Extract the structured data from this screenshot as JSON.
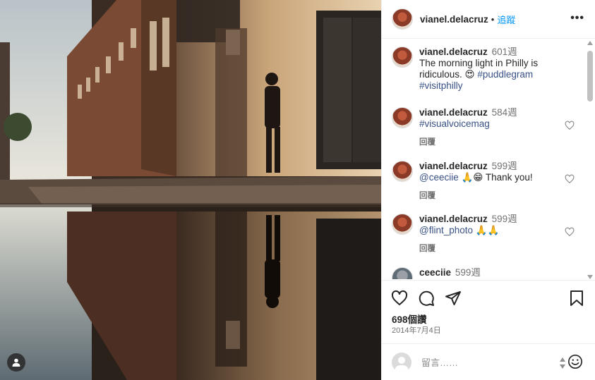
{
  "post": {
    "username": "vianel.delacruz",
    "separator": "•",
    "follow_label": "追蹤",
    "more_label": "•••"
  },
  "comments": [
    {
      "username": "vianel.delacruz",
      "time": "601週",
      "text": "The morning light in Philly is ridiculous. 😍 ",
      "tags": [
        "#puddlegram",
        "#visitphilly"
      ],
      "reply": ""
    },
    {
      "username": "vianel.delacruz",
      "time": "584週",
      "text": "",
      "tags": [
        "#visualvoicemag"
      ],
      "reply": "回覆"
    },
    {
      "username": "vianel.delacruz",
      "time": "599週",
      "text": " 🙏😁  Thank you!",
      "tags": [
        "@ceeciie"
      ],
      "reply": "回覆"
    },
    {
      "username": "vianel.delacruz",
      "time": "599週",
      "text": " 🙏🙏",
      "tags": [
        "@flint_photo"
      ],
      "reply": "回覆"
    },
    {
      "username": "ceeciie",
      "time": "599週",
      "text": "",
      "tags": [],
      "reply": ""
    }
  ],
  "actions": {
    "likes": "698個讚",
    "date": "2014年7月4日"
  },
  "add_comment": {
    "placeholder": "留言……"
  },
  "icons": [
    "like-icon",
    "comment-icon",
    "share-icon",
    "save-icon",
    "emoji-icon",
    "user-tag-icon",
    "more-icon"
  ]
}
